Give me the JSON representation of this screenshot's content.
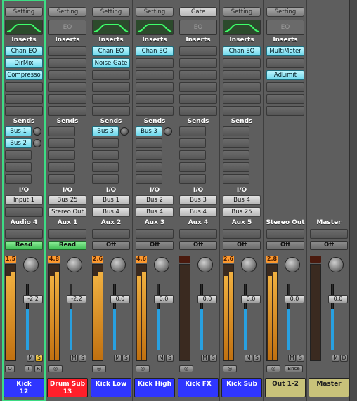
{
  "labels": {
    "setting": "Setting",
    "gate": "Gate",
    "eq": "EQ",
    "inserts": "Inserts",
    "sends": "Sends",
    "io": "I/O"
  },
  "channels": [
    {
      "setting": "Setting",
      "eq_curve": true,
      "inserts": [
        "Chan EQ",
        "DirMix",
        "Compresso"
      ],
      "sends": [
        "Bus 1",
        "Bus 2"
      ],
      "input": "Input 1",
      "output": "",
      "track": "Audio 4",
      "automation": "Read",
      "peak": "1.5",
      "fader": "-2.2",
      "name_line1": "Kick",
      "name_line2": "12",
      "color": "#2f36ff",
      "selected": true
    },
    {
      "setting": "Setting",
      "eq_curve": false,
      "eq_label": "EQ",
      "inserts": [],
      "sends": [],
      "input": "Bus 25",
      "output": "Stereo Out",
      "track": "Aux 1",
      "automation": "Read",
      "peak": "4.8",
      "fader": "-2.2",
      "name_line1": "Drum Sub",
      "name_line2": "13",
      "color": "#ff1f2a",
      "selected": false
    },
    {
      "setting": "Setting",
      "eq_curve": true,
      "inserts": [
        "Chan EQ",
        "Noise Gate"
      ],
      "sends": [
        "Bus 3"
      ],
      "input": "Bus 1",
      "output": "Bus 4",
      "track": "Aux 2",
      "automation": "Off",
      "peak": "2.6",
      "fader": "0.0",
      "name_line1": "Kick Low",
      "name_line2": "",
      "color": "#2f36ff",
      "selected": false
    },
    {
      "setting": "Setting",
      "eq_curve": true,
      "inserts": [
        "Chan EQ"
      ],
      "sends": [
        "Bus 3"
      ],
      "input": "Bus 2",
      "output": "Bus 4",
      "track": "Aux 3",
      "automation": "Off",
      "peak": "4.6",
      "fader": "0.0",
      "name_line1": "Kick High",
      "name_line2": "",
      "color": "#2f36ff",
      "selected": false
    },
    {
      "setting": "Gate",
      "eq_curve": false,
      "eq_label": "EQ",
      "inserts": [],
      "sends": [],
      "input": "Bus 3",
      "output": "Bus 4",
      "track": "Aux 4",
      "automation": "Off",
      "peak": "",
      "fader": "0.0",
      "name_line1": "Kick FX",
      "name_line2": "",
      "color": "#2f36ff",
      "selected": false
    },
    {
      "setting": "Setting",
      "eq_curve": true,
      "inserts": [
        "Chan EQ"
      ],
      "sends": [],
      "input": "Bus 4",
      "output": "Bus 25",
      "track": "Aux 5",
      "automation": "Off",
      "peak": "2.6",
      "fader": "0.0",
      "name_line1": "Kick Sub",
      "name_line2": "",
      "color": "#2f36ff",
      "selected": false
    },
    {
      "setting": "Setting",
      "eq_curve": false,
      "eq_label": "EQ",
      "inserts": [
        "MultiMeter",
        "",
        "AdLimit"
      ],
      "sends": [],
      "input": "",
      "output": "",
      "track": "Stereo Out",
      "automation": "Off",
      "peak": "2.8",
      "fader": "0.0",
      "name_line1": "Out 1-2",
      "name_line2": "",
      "color": "#c8c27a",
      "selected": false,
      "bnce": "Bnce"
    },
    {
      "setting": "",
      "eq_curve": false,
      "inserts": [],
      "sends": [],
      "input": "",
      "output": "",
      "track": "Master",
      "automation": "Off",
      "peak": "",
      "fader": "0.0",
      "name_line1": "Master",
      "name_line2": "",
      "color": "#c8c27a",
      "selected": false
    }
  ],
  "buttons": {
    "mute": "M",
    "solo": "S",
    "dim": "D",
    "input_mon": "I",
    "rec": "R",
    "ovl": "O"
  }
}
